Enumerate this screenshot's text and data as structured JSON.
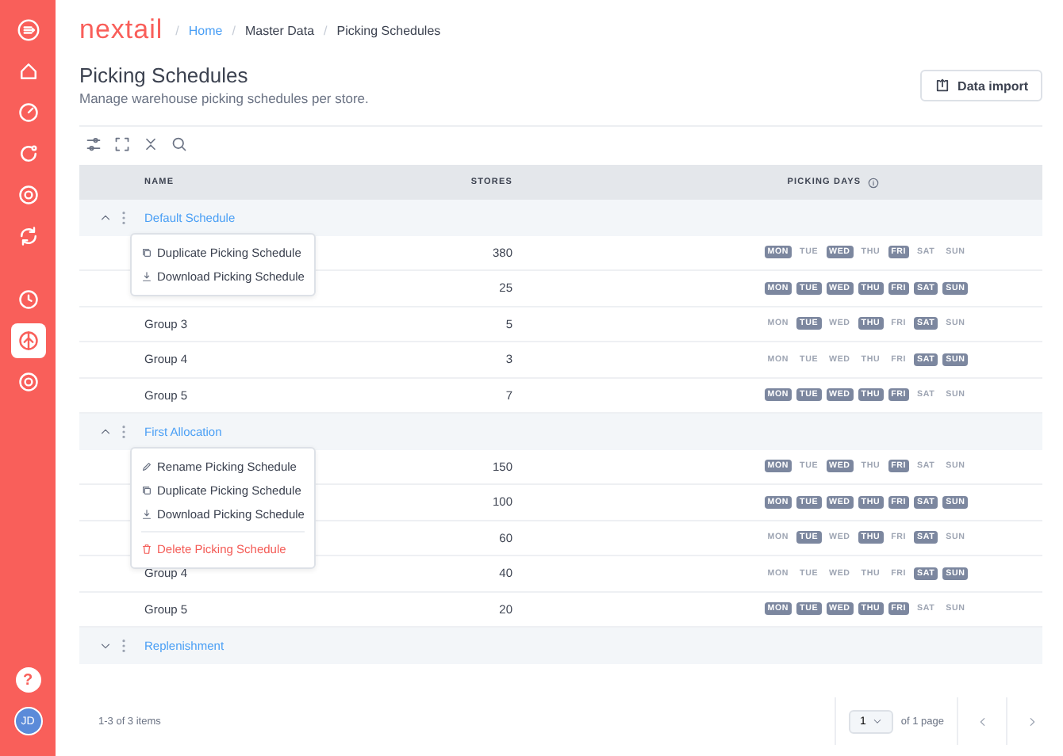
{
  "sidebar": {
    "items": [
      {
        "kind": "menu",
        "selected": false
      },
      {
        "kind": "home",
        "selected": false
      },
      {
        "kind": "gauge",
        "selected": false
      },
      {
        "kind": "refresh",
        "selected": false
      },
      {
        "kind": "target",
        "selected": false
      },
      {
        "kind": "cycle",
        "selected": false
      },
      {
        "kind": "clock",
        "selected": false
      },
      {
        "kind": "split",
        "selected": true
      },
      {
        "kind": "target",
        "selected": false
      }
    ],
    "help": "?",
    "avatar": "JD"
  },
  "header": {
    "logo": "nextail",
    "breadcrumbs": [
      {
        "separator": "/",
        "label": "Home",
        "link": true
      },
      {
        "separator": "/",
        "label": "Master Data",
        "link": false
      },
      {
        "separator": "/",
        "label": "Picking Schedules",
        "link": false
      }
    ]
  },
  "page": {
    "title": "Picking Schedules",
    "subtitle": "Manage warehouse picking schedules per store.",
    "import_button": "Data import"
  },
  "table": {
    "columns": [
      "NAME",
      "STORES",
      "PICKING DAYS"
    ],
    "groups": [
      {
        "name": "Default Schedule",
        "expanded": true,
        "menu": [
          {
            "kind": "duplicate",
            "label": "Duplicate Picking Schedule"
          },
          {
            "kind": "download",
            "label": "Download Picking Schedule"
          }
        ],
        "rows": [
          {
            "stores": "380",
            "days": [
              {
                "label": "MON",
                "on": true
              },
              {
                "label": "TUE",
                "on": false
              },
              {
                "label": "WED",
                "on": true
              },
              {
                "label": "THU",
                "on": false
              },
              {
                "label": "FRI",
                "on": true
              },
              {
                "label": "SAT",
                "on": false
              },
              {
                "label": "SUN",
                "on": false
              }
            ]
          },
          {
            "stores": "25",
            "days": [
              {
                "label": "MON",
                "on": true
              },
              {
                "label": "TUE",
                "on": true
              },
              {
                "label": "WED",
                "on": true
              },
              {
                "label": "THU",
                "on": true
              },
              {
                "label": "FRI",
                "on": true
              },
              {
                "label": "SAT",
                "on": true
              },
              {
                "label": "SUN",
                "on": true
              }
            ]
          },
          {
            "name": "Group 3",
            "stores": "5",
            "days": [
              {
                "label": "MON",
                "on": false
              },
              {
                "label": "TUE",
                "on": true
              },
              {
                "label": "WED",
                "on": false
              },
              {
                "label": "THU",
                "on": true
              },
              {
                "label": "FRI",
                "on": false
              },
              {
                "label": "SAT",
                "on": true
              },
              {
                "label": "SUN",
                "on": false
              }
            ]
          },
          {
            "name": "Group 4",
            "stores": "3",
            "days": [
              {
                "label": "MON",
                "on": false
              },
              {
                "label": "TUE",
                "on": false
              },
              {
                "label": "WED",
                "on": false
              },
              {
                "label": "THU",
                "on": false
              },
              {
                "label": "FRI",
                "on": false
              },
              {
                "label": "SAT",
                "on": true
              },
              {
                "label": "SUN",
                "on": true
              }
            ]
          },
          {
            "name": "Group 5",
            "stores": "7",
            "days": [
              {
                "label": "MON",
                "on": true
              },
              {
                "label": "TUE",
                "on": true
              },
              {
                "label": "WED",
                "on": true
              },
              {
                "label": "THU",
                "on": true
              },
              {
                "label": "FRI",
                "on": true
              },
              {
                "label": "SAT",
                "on": false
              },
              {
                "label": "SUN",
                "on": false
              }
            ]
          }
        ]
      },
      {
        "name": "First Allocation",
        "expanded": true,
        "menu": [
          {
            "kind": "rename",
            "label": "Rename Picking Schedule"
          },
          {
            "kind": "duplicate",
            "label": "Duplicate Picking Schedule"
          },
          {
            "kind": "download",
            "label": "Download Picking Schedule"
          },
          {
            "kind": "delete",
            "label": "Delete Picking Schedule"
          }
        ],
        "rows": [
          {
            "stores": "150",
            "days": [
              {
                "label": "MON",
                "on": true
              },
              {
                "label": "TUE",
                "on": false
              },
              {
                "label": "WED",
                "on": true
              },
              {
                "label": "THU",
                "on": false
              },
              {
                "label": "FRI",
                "on": true
              },
              {
                "label": "SAT",
                "on": false
              },
              {
                "label": "SUN",
                "on": false
              }
            ]
          },
          {
            "stores": "100",
            "days": [
              {
                "label": "MON",
                "on": true
              },
              {
                "label": "TUE",
                "on": true
              },
              {
                "label": "WED",
                "on": true
              },
              {
                "label": "THU",
                "on": true
              },
              {
                "label": "FRI",
                "on": true
              },
              {
                "label": "SAT",
                "on": true
              },
              {
                "label": "SUN",
                "on": true
              }
            ]
          },
          {
            "stores": "60",
            "days": [
              {
                "label": "MON",
                "on": false
              },
              {
                "label": "TUE",
                "on": true
              },
              {
                "label": "WED",
                "on": false
              },
              {
                "label": "THU",
                "on": true
              },
              {
                "label": "FRI",
                "on": false
              },
              {
                "label": "SAT",
                "on": true
              },
              {
                "label": "SUN",
                "on": false
              }
            ]
          },
          {
            "name": "Group 4",
            "stores": "40",
            "days": [
              {
                "label": "MON",
                "on": false
              },
              {
                "label": "TUE",
                "on": false
              },
              {
                "label": "WED",
                "on": false
              },
              {
                "label": "THU",
                "on": false
              },
              {
                "label": "FRI",
                "on": false
              },
              {
                "label": "SAT",
                "on": true
              },
              {
                "label": "SUN",
                "on": true
              }
            ]
          },
          {
            "name": "Group 5",
            "stores": "20",
            "days": [
              {
                "label": "MON",
                "on": true
              },
              {
                "label": "TUE",
                "on": true
              },
              {
                "label": "WED",
                "on": true
              },
              {
                "label": "THU",
                "on": true
              },
              {
                "label": "FRI",
                "on": true
              },
              {
                "label": "SAT",
                "on": false
              },
              {
                "label": "SUN",
                "on": false
              }
            ]
          }
        ]
      },
      {
        "name": "Replenishment",
        "expanded": false
      }
    ]
  },
  "footer": {
    "summary": "1-3 of 3 items",
    "page": "1",
    "page_total": "of 1 page"
  }
}
